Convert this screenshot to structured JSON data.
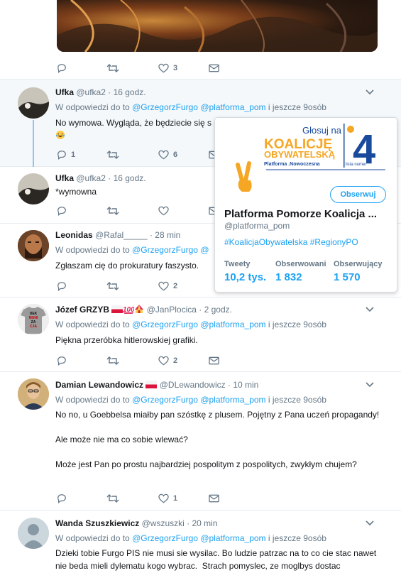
{
  "actions": {
    "reply_icon": "reply-icon",
    "retweet_icon": "retweet-icon",
    "like_icon": "heart-icon",
    "dm_icon": "envelope-icon"
  },
  "top_tweet": {
    "like_count": "3"
  },
  "tweets": [
    {
      "name": "Ufka",
      "handle": "@ufka2",
      "time": "· 16 godz.",
      "reply_prefix": "W odpowiedzi do to",
      "reply_user1": "@GrzegorzFurgo",
      "reply_user2": "@platforma_pom",
      "reply_suffix": "i jeszcze 9osób",
      "text": "No wymowa. Wygląda, że będziecie się s",
      "reply_count": "1",
      "like_count": "6"
    },
    {
      "name": "Ufka",
      "handle": "@ufka2",
      "time": "· 16 godz.",
      "text": "*wymowna"
    },
    {
      "name": "Leonidas",
      "handle": "@Rafal_____",
      "time": "· 28 min",
      "reply_prefix": "W odpowiedzi do to",
      "reply_user1": "@GrzegorzFurgo",
      "reply_user2": "@",
      "text": "Zgłaszam cię do prokuratury faszysto.",
      "like_count": "2"
    },
    {
      "name": "Józef GRZYB",
      "handle": "@JanPlocica",
      "time": "· 2 godz.",
      "reply_prefix": "W odpowiedzi do to",
      "reply_user1": "@GrzegorzFurgo",
      "reply_user2": "@platforma_pom",
      "reply_suffix": "i jeszcze 9osób",
      "text": "Piękna przeróbka hitlerowskiej grafiki.",
      "like_count": "2",
      "avatar_text": [
        "DEK",
        "MUNI",
        "ZA",
        "CJA"
      ]
    },
    {
      "name": "Damian Lewandowicz",
      "handle": "@DLewandowicz",
      "time": "· 10 min",
      "reply_prefix": "W odpowiedzi do to",
      "reply_user1": "@GrzegorzFurgo",
      "reply_user2": "@platforma_pom",
      "reply_suffix": "i jeszcze 9osób",
      "text": "No no, u Goebbelsa miałby pan szóstkę z plusem. Pojętny z Pana uczeń propagandy!\n\nAle może nie ma co sobie wlewać?\n\nMoże jest Pan po prostu najbardziej pospolitym z pospolitych, zwykłym chujem?",
      "like_count": "1"
    },
    {
      "name": "Wanda Szuszkiewicz",
      "handle": "@wszuszki",
      "time": "· 20 min",
      "reply_prefix": "W odpowiedzi do to",
      "reply_user1": "@GrzegorzFurgo",
      "reply_user2": "@platforma_pom",
      "reply_suffix": "i jeszcze 9osób",
      "text": "Dzieki tobie Furgo PIS nie musi sie wysilac. Bo ludzie patrzac na to co cie stac nawet nie beda mieli dylematu kogo wybrac.  Strach pomyslec, ze moglbys dostac"
    }
  ],
  "card": {
    "banner_line1": "Głosuj na",
    "banner_line2": "KOALICJĘ",
    "banner_line3": "OBYWATELSKĄ",
    "banner_line4": "Platforma .Nowoczesna",
    "banner_number": "4",
    "banner_list": "lista numer",
    "follow": "Obserwuj",
    "name": "Platforma Pomorze Koalicja ...",
    "handle": "@platforma_pom",
    "tags": "#KoalicjaObywatelska #RegionyPO",
    "stats": [
      {
        "label": "Tweety",
        "value": "10,2 tys."
      },
      {
        "label": "Obserwowani",
        "value": "1 832"
      },
      {
        "label": "Obserwujący",
        "value": "1 570"
      }
    ]
  },
  "colors": {
    "link": "#1da1f2",
    "muted": "#657786",
    "accent_orange": "#f5a623",
    "accent_blue": "#1a4a9c"
  }
}
